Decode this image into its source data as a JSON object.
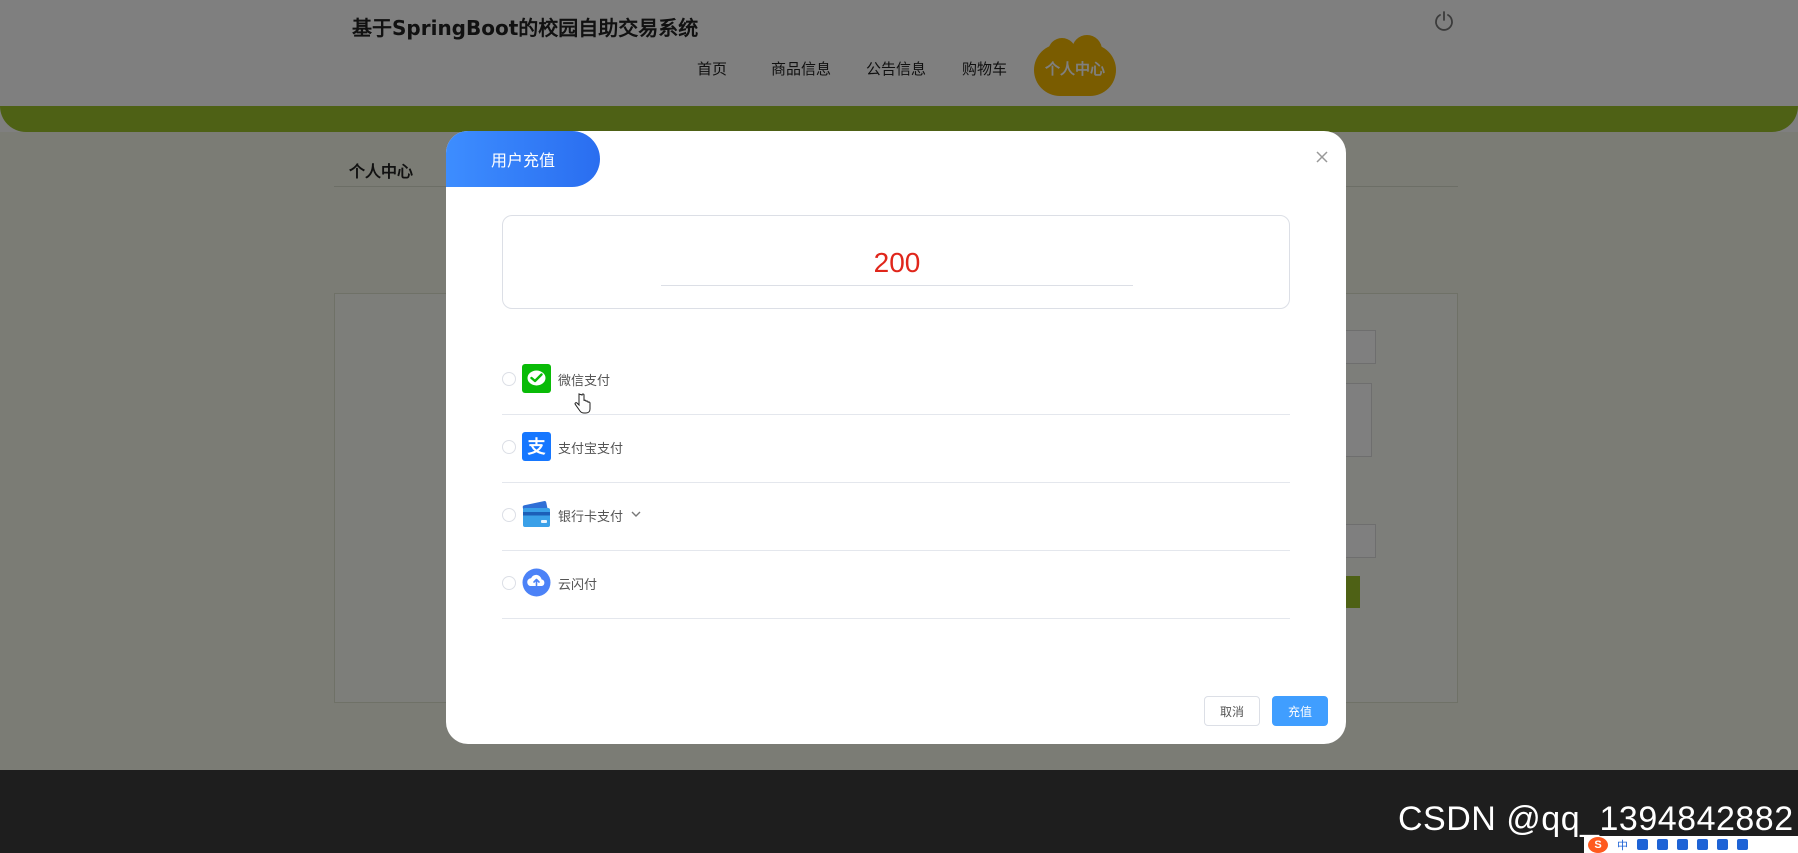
{
  "site": {
    "title": "基于SpringBoot的校园自助交易系统"
  },
  "nav": {
    "items": [
      "首页",
      "商品信息",
      "公告信息",
      "购物车"
    ],
    "active": "个人中心"
  },
  "page": {
    "tab_label": "个人中心"
  },
  "dialog": {
    "title": "用户充值",
    "amount": "200",
    "payment_methods": [
      {
        "label": "微信支付",
        "icon": "wechat-pay-icon"
      },
      {
        "label": "支付宝支付",
        "icon": "alipay-icon"
      },
      {
        "label": "银行卡支付",
        "icon": "bank-card-icon"
      },
      {
        "label": "云闪付",
        "icon": "cloud-quickpass-icon"
      }
    ],
    "cancel_label": "取消",
    "confirm_label": "充值"
  },
  "watermark": "CSDN @qq_1394842882",
  "tray": {
    "ime_logo": "S",
    "ime_mode": "中"
  },
  "colors": {
    "accent_green": "#9cc22a",
    "active_nav": "#f5b800",
    "primary_button": "#409eff",
    "amount_text": "#e0261b",
    "wechat": "#09bb07",
    "alipay": "#1677ff",
    "unionpay_cloud": "#4c82f7"
  }
}
